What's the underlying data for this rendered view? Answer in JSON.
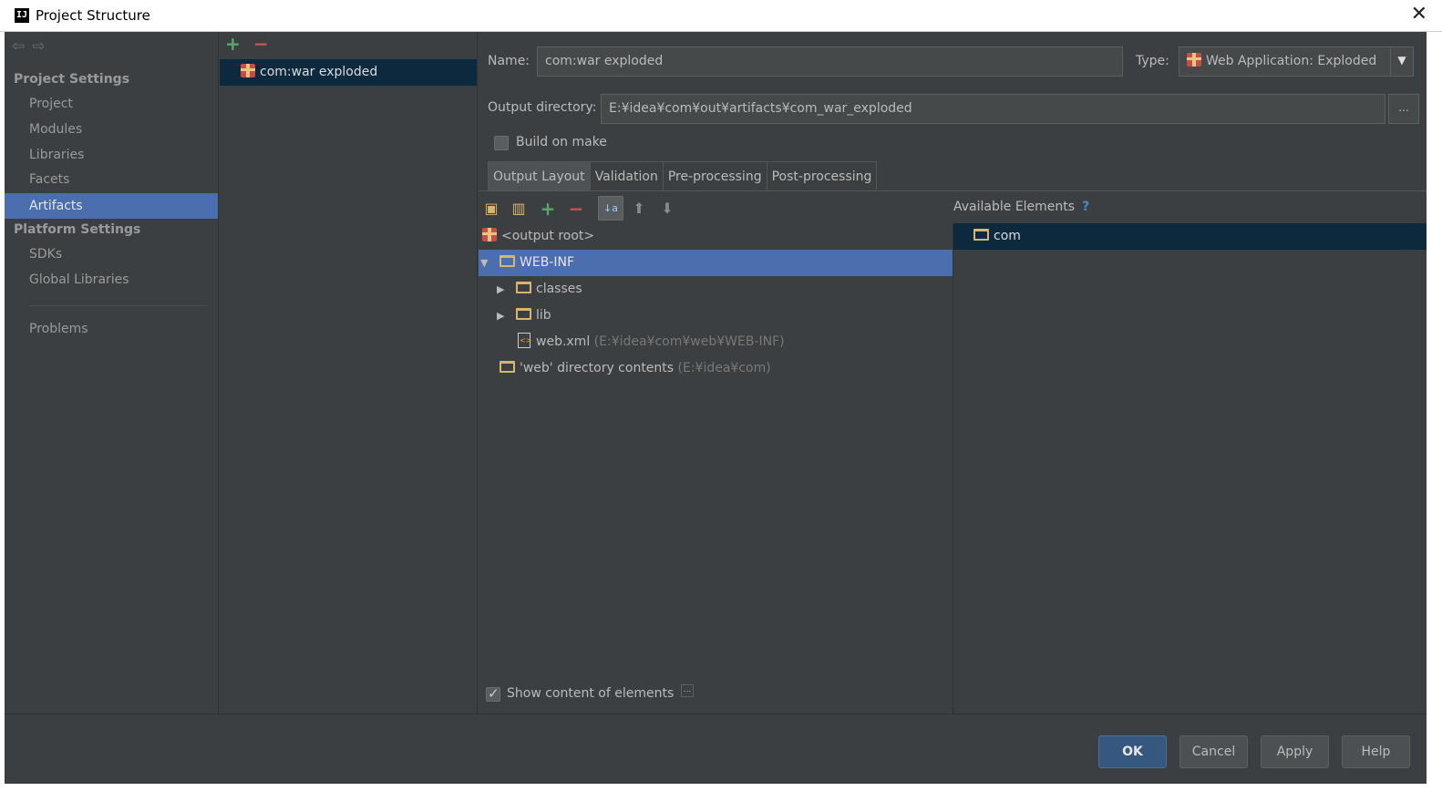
{
  "window": {
    "title": "Project Structure",
    "app_icon": "intellij-icon",
    "close_glyph": "✕"
  },
  "sidebar": {
    "project_settings_heading": "Project Settings",
    "project_items": [
      "Project",
      "Modules",
      "Libraries",
      "Facets",
      "Artifacts"
    ],
    "platform_settings_heading": "Platform Settings",
    "platform_items": [
      "SDKs",
      "Global Libraries"
    ],
    "problems_label": "Problems",
    "selected": "Artifacts"
  },
  "artifacts": {
    "add_glyph": "+",
    "remove_glyph": "−",
    "items": [
      "com:war exploded"
    ]
  },
  "form": {
    "name_label": "Name:",
    "name_value": "com:war exploded",
    "type_label": "Type:",
    "type_value": "Web Application: Exploded",
    "output_dir_label": "Output directory:",
    "output_dir_value": "E:¥idea¥com¥out¥artifacts¥com_war_exploded",
    "browse_label": "...",
    "build_on_make_label": "Build on make",
    "build_on_make_checked": false
  },
  "tabs": [
    "Output Layout",
    "Validation",
    "Pre-processing",
    "Post-processing"
  ],
  "active_tab": "Output Layout",
  "layout_tree": {
    "root": "<output root>",
    "web_inf": "WEB-INF",
    "classes": "classes",
    "lib": "lib",
    "web_xml": "web.xml",
    "web_xml_path": "(E:¥idea¥com¥web¥WEB-INF)",
    "web_dir": "'web' directory contents",
    "web_dir_path": "(E:¥idea¥com)",
    "selected": "WEB-INF"
  },
  "available": {
    "heading": "Available Elements",
    "help_glyph": "?",
    "items": [
      "com"
    ]
  },
  "show_content": {
    "label": "Show content of elements",
    "checked": true,
    "more_label": "..."
  },
  "buttons": {
    "ok": "OK",
    "cancel": "Cancel",
    "apply": "Apply",
    "help": "Help"
  },
  "colors": {
    "selection": "#4b6eaf",
    "dark_selection": "#0d293e",
    "background": "#3c3f41",
    "add": "#59a869",
    "remove": "#c75450"
  }
}
